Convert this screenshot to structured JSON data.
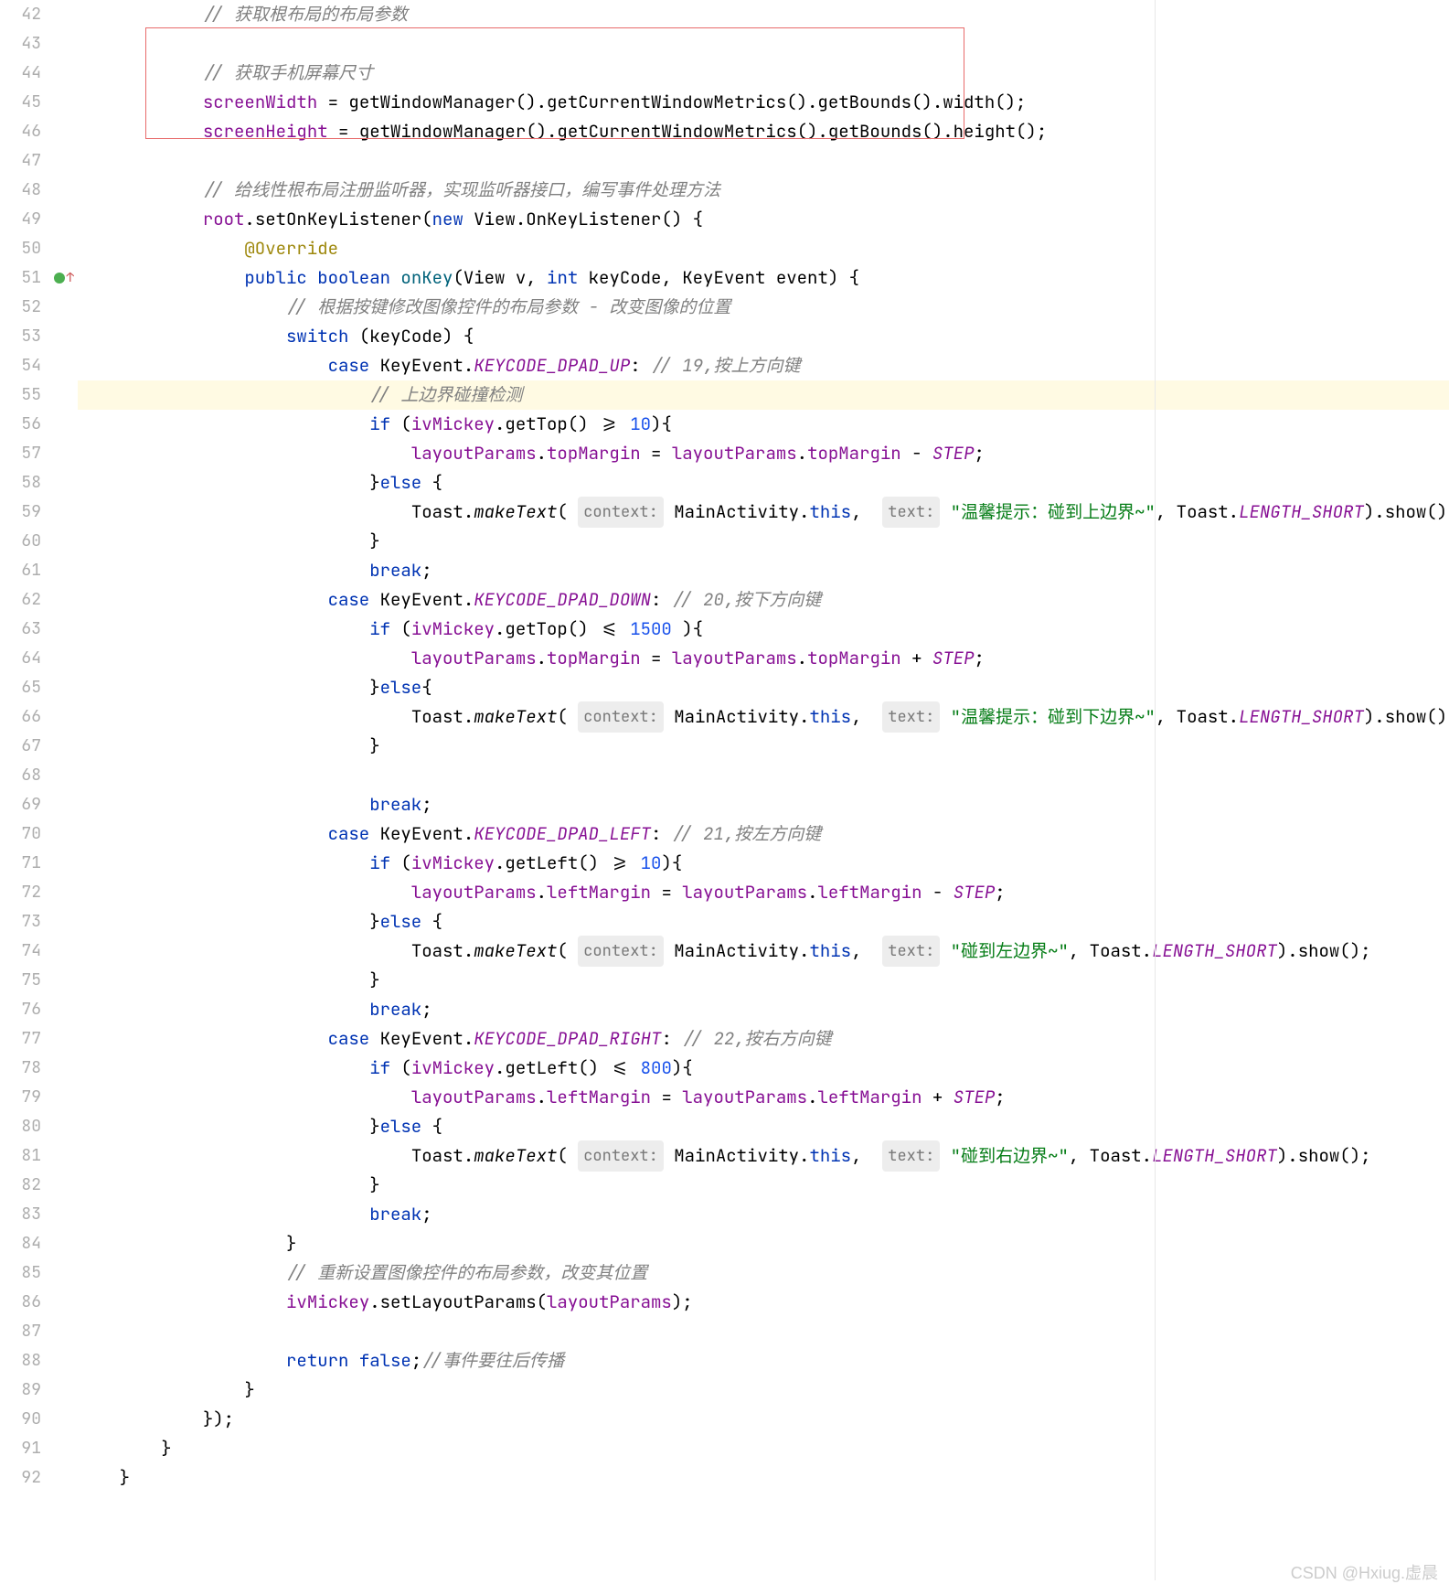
{
  "editor": {
    "startLine": 42,
    "highlightedLine": 55,
    "overrideMarkerLine": 51,
    "lines": [
      {
        "indent": 3,
        "tokens": [
          {
            "t": "comment",
            "v": "// 获取根布局的布局参数"
          }
        ]
      },
      {
        "indent": 0,
        "tokens": []
      },
      {
        "indent": 3,
        "tokens": [
          {
            "t": "comment",
            "v": "// 获取手机屏幕尺寸"
          }
        ]
      },
      {
        "indent": 3,
        "tokens": [
          {
            "t": "field",
            "v": "screenWidth"
          },
          {
            "t": "plain",
            "v": " = getWindowManager().getCurrentWindowMetrics().getBounds().width();"
          }
        ]
      },
      {
        "indent": 3,
        "tokens": [
          {
            "t": "field",
            "v": "screenHeight"
          },
          {
            "t": "plain",
            "v": " = getWindowManager().getCurrentWindowMetrics().getBounds().height();"
          }
        ]
      },
      {
        "indent": 0,
        "tokens": []
      },
      {
        "indent": 3,
        "tokens": [
          {
            "t": "comment",
            "v": "// 给线性根布局注册监听器，实现监听器接口，编写事件处理方法"
          }
        ]
      },
      {
        "indent": 3,
        "tokens": [
          {
            "t": "field",
            "v": "root"
          },
          {
            "t": "plain",
            "v": ".setOnKeyListener("
          },
          {
            "t": "keyword",
            "v": "new"
          },
          {
            "t": "plain",
            "v": " View.OnKeyListener() {"
          }
        ]
      },
      {
        "indent": 4,
        "tokens": [
          {
            "t": "annotation",
            "v": "@Override"
          }
        ]
      },
      {
        "indent": 4,
        "tokens": [
          {
            "t": "keyword",
            "v": "public boolean "
          },
          {
            "t": "method",
            "v": "onKey"
          },
          {
            "t": "plain",
            "v": "(View v, "
          },
          {
            "t": "keyword",
            "v": "int"
          },
          {
            "t": "plain",
            "v": " keyCode, KeyEvent event) {"
          }
        ]
      },
      {
        "indent": 5,
        "tokens": [
          {
            "t": "comment",
            "v": "// 根据按键修改图像控件的布局参数 - 改变图像的位置"
          }
        ]
      },
      {
        "indent": 5,
        "tokens": [
          {
            "t": "keyword",
            "v": "switch"
          },
          {
            "t": "plain",
            "v": " (keyCode) {"
          }
        ]
      },
      {
        "indent": 6,
        "tokens": [
          {
            "t": "keyword",
            "v": "case"
          },
          {
            "t": "plain",
            "v": " KeyEvent."
          },
          {
            "t": "const",
            "v": "KEYCODE_DPAD_UP"
          },
          {
            "t": "plain",
            "v": ": "
          },
          {
            "t": "comment",
            "v": "// 19,按上方向键"
          }
        ]
      },
      {
        "indent": 7,
        "tokens": [
          {
            "t": "comment",
            "v": "// 上边界碰撞检测"
          }
        ]
      },
      {
        "indent": 7,
        "tokens": [
          {
            "t": "keyword",
            "v": "if"
          },
          {
            "t": "plain",
            "v": " ("
          },
          {
            "t": "field",
            "v": "ivMickey"
          },
          {
            "t": "plain",
            "v": ".getTop() >= "
          },
          {
            "t": "number",
            "v": "10"
          },
          {
            "t": "plain",
            "v": "){"
          }
        ]
      },
      {
        "indent": 8,
        "tokens": [
          {
            "t": "field",
            "v": "layoutParams"
          },
          {
            "t": "plain",
            "v": "."
          },
          {
            "t": "field",
            "v": "topMargin"
          },
          {
            "t": "plain",
            "v": " = "
          },
          {
            "t": "field",
            "v": "layoutParams"
          },
          {
            "t": "plain",
            "v": "."
          },
          {
            "t": "field",
            "v": "topMargin"
          },
          {
            "t": "plain",
            "v": " - "
          },
          {
            "t": "const",
            "v": "STEP"
          },
          {
            "t": "plain",
            "v": ";"
          }
        ]
      },
      {
        "indent": 7,
        "tokens": [
          {
            "t": "plain",
            "v": "}"
          },
          {
            "t": "keyword",
            "v": "else"
          },
          {
            "t": "plain",
            "v": " {"
          }
        ]
      },
      {
        "indent": 8,
        "tokens": [
          {
            "t": "plain",
            "v": "Toast."
          },
          {
            "t": "methoditalic",
            "v": "makeText"
          },
          {
            "t": "plain",
            "v": "( "
          },
          {
            "t": "hint",
            "v": "context:"
          },
          {
            "t": "plain",
            "v": " MainActivity."
          },
          {
            "t": "keyword",
            "v": "this"
          },
          {
            "t": "plain",
            "v": ",  "
          },
          {
            "t": "hint",
            "v": "text:"
          },
          {
            "t": "plain",
            "v": " "
          },
          {
            "t": "string",
            "v": "\"温馨提示：碰到上边界~\""
          },
          {
            "t": "plain",
            "v": ", Toast."
          },
          {
            "t": "const",
            "v": "LENGTH_SHORT"
          },
          {
            "t": "plain",
            "v": ").show();"
          }
        ]
      },
      {
        "indent": 7,
        "tokens": [
          {
            "t": "plain",
            "v": "}"
          }
        ]
      },
      {
        "indent": 7,
        "tokens": [
          {
            "t": "keyword",
            "v": "break"
          },
          {
            "t": "plain",
            "v": ";"
          }
        ]
      },
      {
        "indent": 6,
        "tokens": [
          {
            "t": "keyword",
            "v": "case"
          },
          {
            "t": "plain",
            "v": " KeyEvent."
          },
          {
            "t": "const",
            "v": "KEYCODE_DPAD_DOWN"
          },
          {
            "t": "plain",
            "v": ": "
          },
          {
            "t": "comment",
            "v": "// 20,按下方向键"
          }
        ]
      },
      {
        "indent": 7,
        "tokens": [
          {
            "t": "keyword",
            "v": "if"
          },
          {
            "t": "plain",
            "v": " ("
          },
          {
            "t": "field",
            "v": "ivMickey"
          },
          {
            "t": "plain",
            "v": ".getTop() <= "
          },
          {
            "t": "number",
            "v": "1500"
          },
          {
            "t": "plain",
            "v": " ){"
          }
        ]
      },
      {
        "indent": 8,
        "tokens": [
          {
            "t": "field",
            "v": "layoutParams"
          },
          {
            "t": "plain",
            "v": "."
          },
          {
            "t": "field",
            "v": "topMargin"
          },
          {
            "t": "plain",
            "v": " = "
          },
          {
            "t": "field",
            "v": "layoutParams"
          },
          {
            "t": "plain",
            "v": "."
          },
          {
            "t": "field",
            "v": "topMargin"
          },
          {
            "t": "plain",
            "v": " + "
          },
          {
            "t": "const",
            "v": "STEP"
          },
          {
            "t": "plain",
            "v": ";"
          }
        ]
      },
      {
        "indent": 7,
        "tokens": [
          {
            "t": "plain",
            "v": "}"
          },
          {
            "t": "keyword",
            "v": "else"
          },
          {
            "t": "plain",
            "v": "{"
          }
        ]
      },
      {
        "indent": 8,
        "tokens": [
          {
            "t": "plain",
            "v": "Toast."
          },
          {
            "t": "methoditalic",
            "v": "makeText"
          },
          {
            "t": "plain",
            "v": "( "
          },
          {
            "t": "hint",
            "v": "context:"
          },
          {
            "t": "plain",
            "v": " MainActivity."
          },
          {
            "t": "keyword",
            "v": "this"
          },
          {
            "t": "plain",
            "v": ",  "
          },
          {
            "t": "hint",
            "v": "text:"
          },
          {
            "t": "plain",
            "v": " "
          },
          {
            "t": "string",
            "v": "\"温馨提示：碰到下边界~\""
          },
          {
            "t": "plain",
            "v": ", Toast."
          },
          {
            "t": "const",
            "v": "LENGTH_SHORT"
          },
          {
            "t": "plain",
            "v": ").show();"
          }
        ]
      },
      {
        "indent": 7,
        "tokens": [
          {
            "t": "plain",
            "v": "}"
          }
        ]
      },
      {
        "indent": 0,
        "tokens": []
      },
      {
        "indent": 7,
        "tokens": [
          {
            "t": "keyword",
            "v": "break"
          },
          {
            "t": "plain",
            "v": ";"
          }
        ]
      },
      {
        "indent": 6,
        "tokens": [
          {
            "t": "keyword",
            "v": "case"
          },
          {
            "t": "plain",
            "v": " KeyEvent."
          },
          {
            "t": "const",
            "v": "KEYCODE_DPAD_LEFT"
          },
          {
            "t": "plain",
            "v": ": "
          },
          {
            "t": "comment",
            "v": "// 21,按左方向键"
          }
        ]
      },
      {
        "indent": 7,
        "tokens": [
          {
            "t": "keyword",
            "v": "if"
          },
          {
            "t": "plain",
            "v": " ("
          },
          {
            "t": "field",
            "v": "ivMickey"
          },
          {
            "t": "plain",
            "v": ".getLeft() >= "
          },
          {
            "t": "number",
            "v": "10"
          },
          {
            "t": "plain",
            "v": "){"
          }
        ]
      },
      {
        "indent": 8,
        "tokens": [
          {
            "t": "field",
            "v": "layoutParams"
          },
          {
            "t": "plain",
            "v": "."
          },
          {
            "t": "field",
            "v": "leftMargin"
          },
          {
            "t": "plain",
            "v": " = "
          },
          {
            "t": "field",
            "v": "layoutParams"
          },
          {
            "t": "plain",
            "v": "."
          },
          {
            "t": "field",
            "v": "leftMargin"
          },
          {
            "t": "plain",
            "v": " - "
          },
          {
            "t": "const",
            "v": "STEP"
          },
          {
            "t": "plain",
            "v": ";"
          }
        ]
      },
      {
        "indent": 7,
        "tokens": [
          {
            "t": "plain",
            "v": "}"
          },
          {
            "t": "keyword",
            "v": "else"
          },
          {
            "t": "plain",
            "v": " {"
          }
        ]
      },
      {
        "indent": 8,
        "tokens": [
          {
            "t": "plain",
            "v": "Toast."
          },
          {
            "t": "methoditalic",
            "v": "makeText"
          },
          {
            "t": "plain",
            "v": "( "
          },
          {
            "t": "hint",
            "v": "context:"
          },
          {
            "t": "plain",
            "v": " MainActivity."
          },
          {
            "t": "keyword",
            "v": "this"
          },
          {
            "t": "plain",
            "v": ",  "
          },
          {
            "t": "hint",
            "v": "text:"
          },
          {
            "t": "plain",
            "v": " "
          },
          {
            "t": "string",
            "v": "\"碰到左边界~\""
          },
          {
            "t": "plain",
            "v": ", Toast."
          },
          {
            "t": "const",
            "v": "LENGTH_SHORT"
          },
          {
            "t": "plain",
            "v": ").show();"
          }
        ]
      },
      {
        "indent": 7,
        "tokens": [
          {
            "t": "plain",
            "v": "}"
          }
        ]
      },
      {
        "indent": 7,
        "tokens": [
          {
            "t": "keyword",
            "v": "break"
          },
          {
            "t": "plain",
            "v": ";"
          }
        ]
      },
      {
        "indent": 6,
        "tokens": [
          {
            "t": "keyword",
            "v": "case"
          },
          {
            "t": "plain",
            "v": " KeyEvent."
          },
          {
            "t": "const",
            "v": "KEYCODE_DPAD_RIGHT"
          },
          {
            "t": "plain",
            "v": ": "
          },
          {
            "t": "comment",
            "v": "// 22,按右方向键"
          }
        ]
      },
      {
        "indent": 7,
        "tokens": [
          {
            "t": "keyword",
            "v": "if"
          },
          {
            "t": "plain",
            "v": " ("
          },
          {
            "t": "field",
            "v": "ivMickey"
          },
          {
            "t": "plain",
            "v": ".getLeft() <= "
          },
          {
            "t": "number",
            "v": "800"
          },
          {
            "t": "plain",
            "v": "){"
          }
        ]
      },
      {
        "indent": 8,
        "tokens": [
          {
            "t": "field",
            "v": "layoutParams"
          },
          {
            "t": "plain",
            "v": "."
          },
          {
            "t": "field",
            "v": "leftMargin"
          },
          {
            "t": "plain",
            "v": " = "
          },
          {
            "t": "field",
            "v": "layoutParams"
          },
          {
            "t": "plain",
            "v": "."
          },
          {
            "t": "field",
            "v": "leftMargin"
          },
          {
            "t": "plain",
            "v": " + "
          },
          {
            "t": "const",
            "v": "STEP"
          },
          {
            "t": "plain",
            "v": ";"
          }
        ]
      },
      {
        "indent": 7,
        "tokens": [
          {
            "t": "plain",
            "v": "}"
          },
          {
            "t": "keyword",
            "v": "else"
          },
          {
            "t": "plain",
            "v": " {"
          }
        ]
      },
      {
        "indent": 8,
        "tokens": [
          {
            "t": "plain",
            "v": "Toast."
          },
          {
            "t": "methoditalic",
            "v": "makeText"
          },
          {
            "t": "plain",
            "v": "( "
          },
          {
            "t": "hint",
            "v": "context:"
          },
          {
            "t": "plain",
            "v": " MainActivity."
          },
          {
            "t": "keyword",
            "v": "this"
          },
          {
            "t": "plain",
            "v": ",  "
          },
          {
            "t": "hint",
            "v": "text:"
          },
          {
            "t": "plain",
            "v": " "
          },
          {
            "t": "string",
            "v": "\"碰到右边界~\""
          },
          {
            "t": "plain",
            "v": ", Toast."
          },
          {
            "t": "const",
            "v": "LENGTH_SHORT"
          },
          {
            "t": "plain",
            "v": ").show();"
          }
        ]
      },
      {
        "indent": 7,
        "tokens": [
          {
            "t": "plain",
            "v": "}"
          }
        ]
      },
      {
        "indent": 7,
        "tokens": [
          {
            "t": "keyword",
            "v": "break"
          },
          {
            "t": "plain",
            "v": ";"
          }
        ]
      },
      {
        "indent": 5,
        "tokens": [
          {
            "t": "plain",
            "v": "}"
          }
        ]
      },
      {
        "indent": 5,
        "tokens": [
          {
            "t": "comment",
            "v": "// 重新设置图像控件的布局参数，改变其位置"
          }
        ]
      },
      {
        "indent": 5,
        "tokens": [
          {
            "t": "field",
            "v": "ivMickey"
          },
          {
            "t": "plain",
            "v": ".setLayoutParams("
          },
          {
            "t": "field",
            "v": "layoutParams"
          },
          {
            "t": "plain",
            "v": ");"
          }
        ]
      },
      {
        "indent": 0,
        "tokens": []
      },
      {
        "indent": 5,
        "tokens": [
          {
            "t": "keyword",
            "v": "return false"
          },
          {
            "t": "plain",
            "v": ";"
          },
          {
            "t": "comment",
            "v": "//事件要往后传播"
          }
        ]
      },
      {
        "indent": 4,
        "tokens": [
          {
            "t": "plain",
            "v": "}"
          }
        ]
      },
      {
        "indent": 3,
        "tokens": [
          {
            "t": "plain",
            "v": "});"
          }
        ]
      },
      {
        "indent": 2,
        "tokens": [
          {
            "t": "plain",
            "v": "}"
          }
        ]
      },
      {
        "indent": 1,
        "tokens": [
          {
            "t": "plain",
            "v": "}"
          }
        ]
      }
    ]
  },
  "watermark": "CSDN @Hxiug.虚晨"
}
